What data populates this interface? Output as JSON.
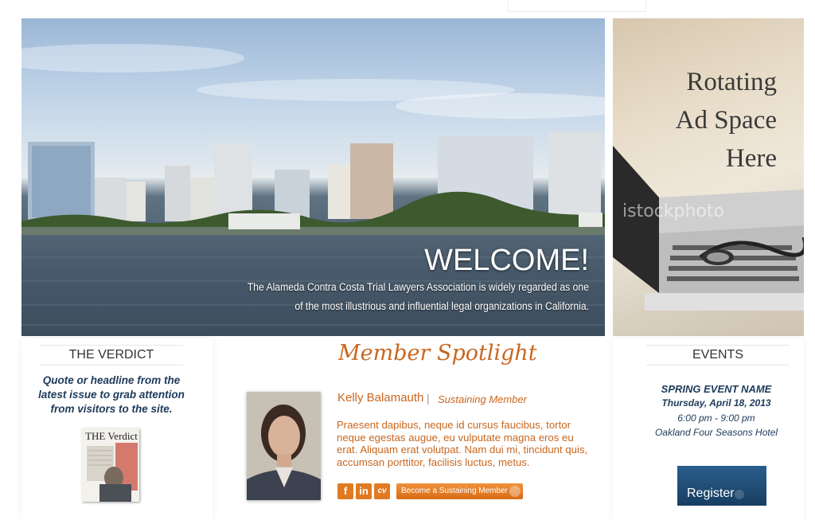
{
  "hero": {
    "heading": "WELCOME!",
    "text": "The Alameda Contra Costa Trial Lawyers Association is widely regarded as one of the most illustrious and influential legal organizations in California."
  },
  "ad": {
    "line1": "Rotating",
    "line2": "Ad Space",
    "line3": "Here",
    "watermark": "istockphoto"
  },
  "verdict": {
    "title": "THE VERDICT",
    "quote": "Quote or headline from the latest issue to grab attention from visitors to the site.",
    "cover_title": "THE Verdict"
  },
  "spotlight": {
    "title": "Member Spotlight",
    "name": "Kelly Balamauth",
    "separator": "|",
    "role": "Sustaining Member",
    "bio": "Praesent dapibus, neque id cursus faucibus, tortor neque egestas augue, eu vulputate magna eros eu erat. Aliquam erat volutpat. Nam dui mi, tincidunt quis, accumsan porttitor, facilisis luctus, metus.",
    "social_fb": "f",
    "social_li": "in",
    "social_cv": "cv",
    "cta": "Become a Sustaining Member"
  },
  "events": {
    "title": "EVENTS",
    "name": "SPRING EVENT NAME",
    "date": "Thursday, April 18, 2013",
    "time": "6:00 pm - 9:00 pm",
    "place": "Oakland Four Seasons Hotel",
    "register": "Register"
  },
  "colors": {
    "accent": "#c9671f",
    "navy": "#1d3a5a",
    "button_blue": "#1f4b74"
  }
}
